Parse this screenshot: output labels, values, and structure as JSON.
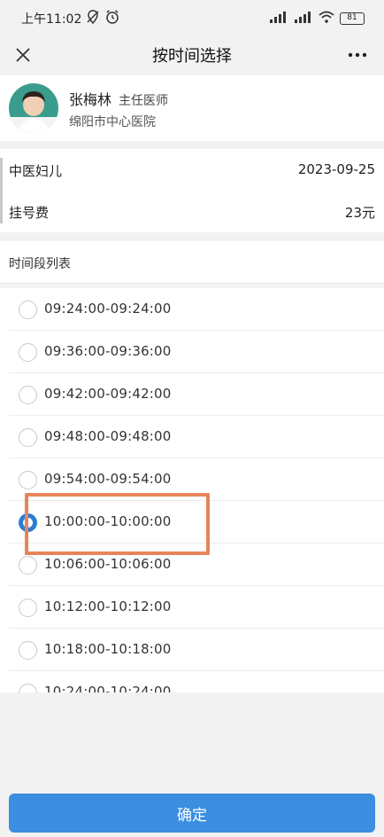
{
  "status_bar": {
    "time": "上午11:02",
    "battery": "81"
  },
  "nav": {
    "title": "按时间选择"
  },
  "doctor": {
    "name": "张梅林",
    "title": "主任医师",
    "hospital": "绵阳市中心医院"
  },
  "info": {
    "department": "中医妇儿",
    "date": "2023-09-25",
    "fee_label": "挂号费",
    "fee_value": "23元"
  },
  "section": {
    "title": "时间段列表"
  },
  "slots": [
    {
      "label": "09:24:00-09:24:00",
      "selected": false
    },
    {
      "label": "09:36:00-09:36:00",
      "selected": false
    },
    {
      "label": "09:42:00-09:42:00",
      "selected": false
    },
    {
      "label": "09:48:00-09:48:00",
      "selected": false
    },
    {
      "label": "09:54:00-09:54:00",
      "selected": false
    },
    {
      "label": "10:00:00-10:00:00",
      "selected": true
    },
    {
      "label": "10:06:00-10:06:00",
      "selected": false
    },
    {
      "label": "10:12:00-10:12:00",
      "selected": false
    },
    {
      "label": "10:18:00-10:18:00",
      "selected": false
    },
    {
      "label": "10:24:00-10:24:00",
      "selected": false
    }
  ],
  "footer": {
    "confirm_label": "确定"
  },
  "colors": {
    "primary": "#3b8ee0",
    "radio_checked": "#2a7fd4",
    "highlight": "#e8845a"
  }
}
